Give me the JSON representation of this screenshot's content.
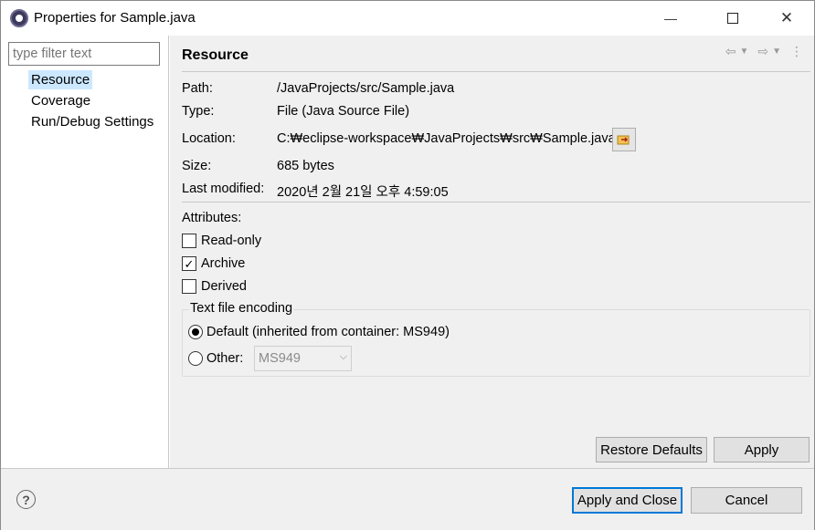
{
  "window": {
    "title": "Properties for Sample.java",
    "minimize_glyph": "—",
    "maximize_glyph": "☐",
    "close_glyph": "✕"
  },
  "sidebar": {
    "filter_placeholder": "type filter text",
    "items": [
      {
        "label": "Resource",
        "selected": true
      },
      {
        "label": "Coverage",
        "selected": false
      },
      {
        "label": "Run/Debug Settings",
        "selected": false
      }
    ]
  },
  "resource": {
    "title": "Resource",
    "path_label": "Path:",
    "path_value": "/JavaProjects/src/Sample.java",
    "type_label": "Type:",
    "type_value": "File  (Java Source File)",
    "location_label": "Location:",
    "location_value": "C:₩eclipse-workspace₩JavaProjects₩src₩Sample.java",
    "size_label": "Size:",
    "size_value": "685  bytes",
    "modified_label": "Last modified:",
    "modified_value": "2020년 2월 21일 오후 4:59:05",
    "attributes_label": "Attributes:",
    "read_only_label": "Read-only",
    "read_only_checked": false,
    "archive_label": "Archive",
    "archive_checked": true,
    "derived_label": "Derived",
    "derived_checked": false,
    "encoding_group_label": "Text file encoding",
    "default_radio_label": "Default (inherited from container: MS949)",
    "default_selected": true,
    "other_radio_label": "Other:",
    "other_value": "MS949",
    "restore_defaults_label": "Restore Defaults",
    "apply_label": "Apply"
  },
  "footer": {
    "help_glyph": "?",
    "apply_close_label": "Apply and Close",
    "cancel_label": "Cancel"
  },
  "colors": {
    "selection": "#cce8ff",
    "default_button_border": "#0078d7",
    "panel_bg": "#f0f0f0"
  }
}
